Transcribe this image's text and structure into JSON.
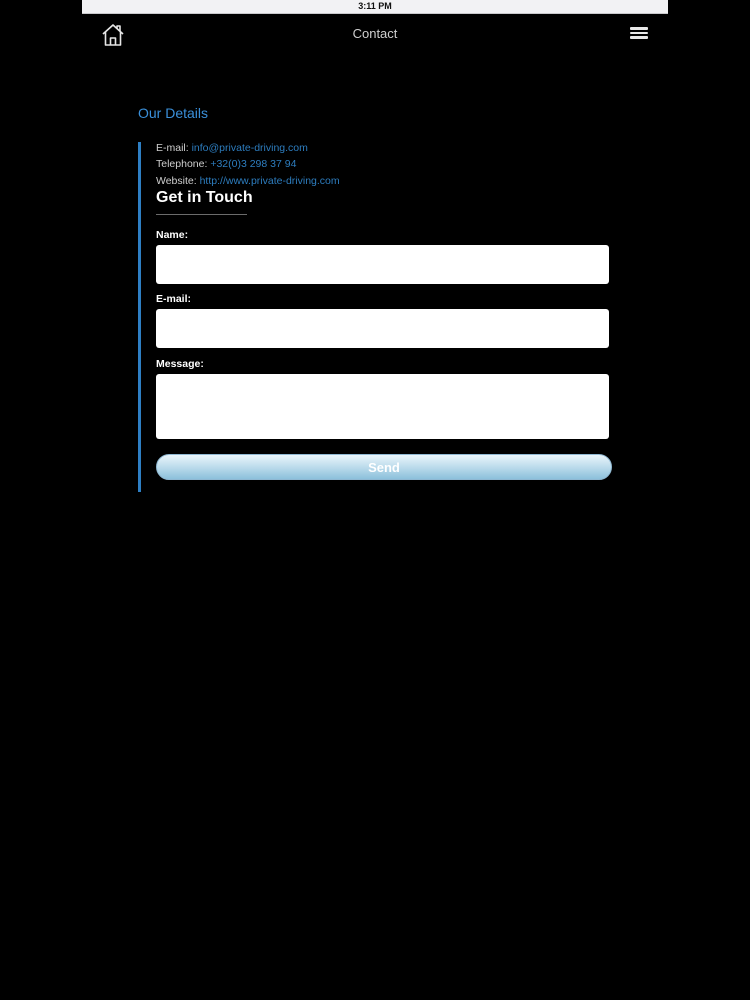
{
  "status_bar": {
    "time": "3:11 PM"
  },
  "nav": {
    "title": "Contact",
    "home_icon": "home-icon",
    "menu_icon": "hamburger-menu-icon"
  },
  "details": {
    "section_title": "Our Details",
    "email_label": "E-mail:",
    "email_value": "info@private-driving.com",
    "phone_label": "Telephone:",
    "phone_value": "+32(0)3 298 37 94",
    "website_label": "Website:",
    "website_value": "http://www.private-driving.com"
  },
  "form": {
    "heading": "Get in Touch",
    "name_label": "Name:",
    "name_value": "",
    "email_label": "E-mail:",
    "email_value": "",
    "message_label": "Message:",
    "message_value": "",
    "send_label": "Send"
  },
  "colors": {
    "background": "#000000",
    "accent": "#2e7fc4",
    "link": "#2d7dbf",
    "button": "#a9d0e5"
  }
}
